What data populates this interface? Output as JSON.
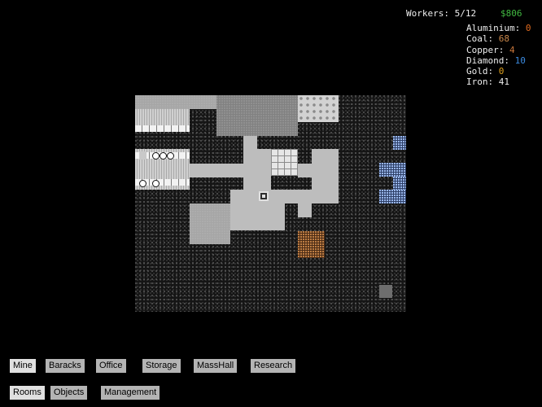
{
  "hud": {
    "workers_label": "Workers: 5/12",
    "money": "$806",
    "money_color": "#41b941"
  },
  "resources": [
    {
      "name": "Aluminium:",
      "value": "0",
      "color": "#e06a1f"
    },
    {
      "name": "Coal:",
      "value": "68",
      "color": "#c9874a"
    },
    {
      "name": "Copper:",
      "value": "4",
      "color": "#c8763b"
    },
    {
      "name": "Diamond:",
      "value": "10",
      "color": "#3b8be0"
    },
    {
      "name": "Gold:",
      "value": "0",
      "color": "#e0a21f"
    },
    {
      "name": "Iron:",
      "value": "41",
      "color": "#eeeeee"
    }
  ],
  "toolbar_rooms": [
    {
      "label": "Mine",
      "active": true
    },
    {
      "label": "Baracks",
      "active": false
    },
    {
      "label": "Office",
      "active": false
    },
    {
      "label": "Storage",
      "active": false
    },
    {
      "label": "MassHall",
      "active": false
    },
    {
      "label": "Research",
      "active": false
    }
  ],
  "toolbar_categories": [
    {
      "label": "Rooms",
      "active": true
    },
    {
      "label": "Objects",
      "active": false
    },
    {
      "label": "Management",
      "active": false
    }
  ]
}
